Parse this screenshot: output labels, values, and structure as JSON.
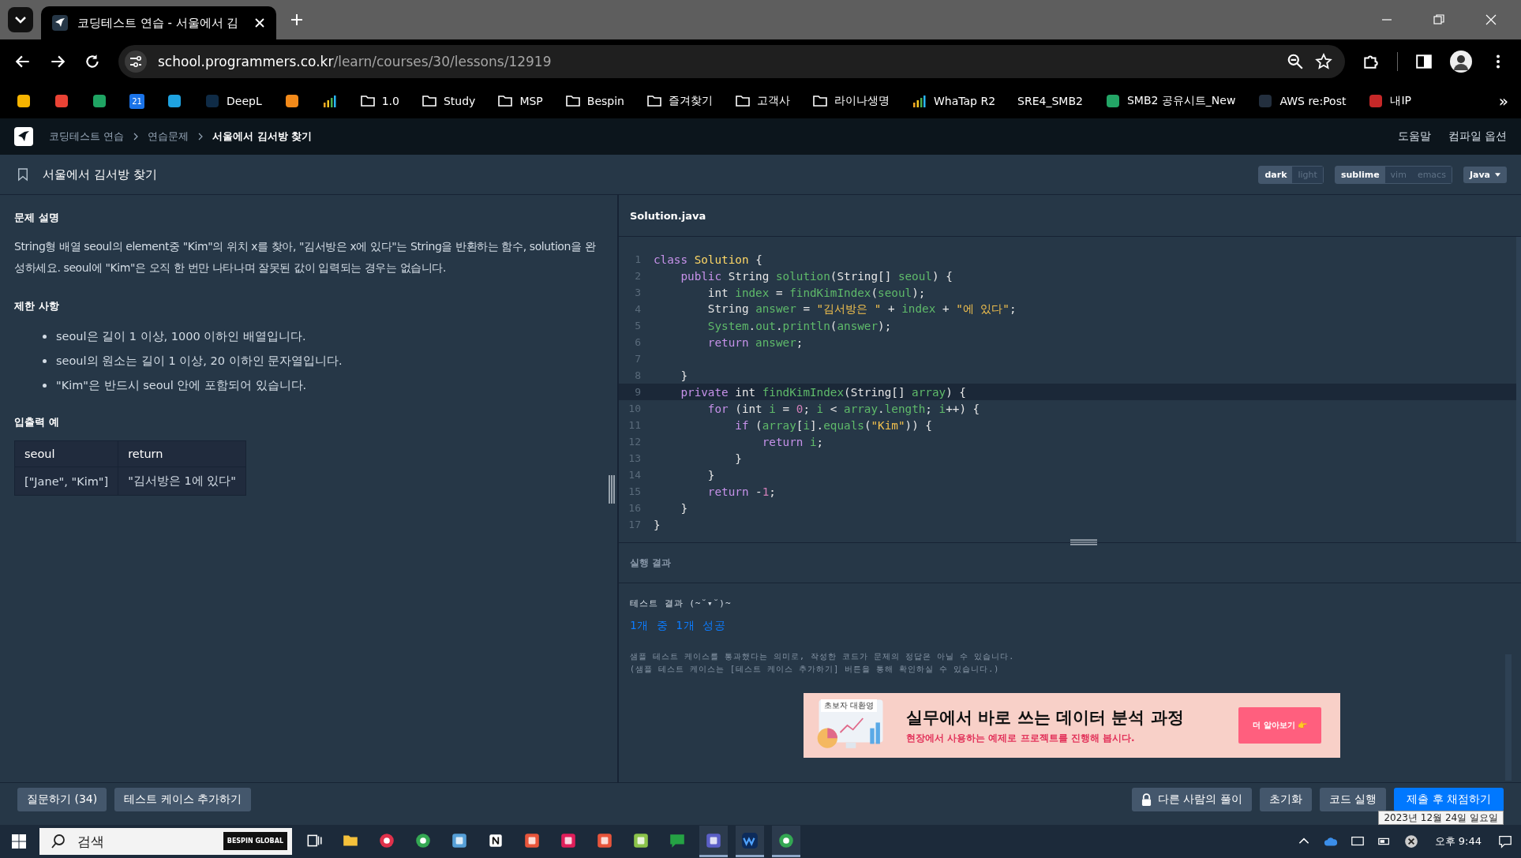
{
  "browser": {
    "tabs": [
      {
        "title": "코딩테스트 연습 - 서울에서 김",
        "selected": true
      }
    ],
    "url_host": "school.programmers.co.kr",
    "url_path": "/learn/courses/30/lessons/12919",
    "bookmarks": [
      {
        "kind": "site",
        "color": "#f6b400"
      },
      {
        "kind": "site",
        "color": "#ea4335"
      },
      {
        "kind": "site",
        "color": "#1fa463"
      },
      {
        "kind": "calendar",
        "icon_text": "21"
      },
      {
        "kind": "site",
        "color": "#1fa2e0"
      },
      {
        "kind": "site",
        "color": "#0f2b46",
        "label": "DeepL"
      },
      {
        "kind": "site",
        "color": "#f28a1a"
      },
      {
        "kind": "bars"
      },
      {
        "kind": "folder",
        "label": "1.0"
      },
      {
        "kind": "folder",
        "label": "Study"
      },
      {
        "kind": "folder",
        "label": "MSP"
      },
      {
        "kind": "folder",
        "label": "Bespin"
      },
      {
        "kind": "folder",
        "label": "즐겨찾기"
      },
      {
        "kind": "folder",
        "label": "고객사"
      },
      {
        "kind": "folder",
        "label": "라이나생명"
      },
      {
        "kind": "bars",
        "label": "WhaTap R2"
      },
      {
        "kind": "plain",
        "label": "SRE4_SMB2"
      },
      {
        "kind": "site",
        "color": "#23a566",
        "label": "SMB2 공유시트_New"
      },
      {
        "kind": "site",
        "color": "#232f3e",
        "label": "AWS re:Post"
      },
      {
        "kind": "site",
        "color": "#c62828",
        "label": "내IP"
      }
    ],
    "more": "»"
  },
  "site_nav": {
    "breadcrumb": [
      "코딩테스트 연습",
      "연습문제",
      "서울에서 김서방 찾기"
    ],
    "links": [
      "도움말",
      "컴파일 옵션"
    ]
  },
  "problem_title": "서울에서 김서방 찾기",
  "toggles": [
    [
      {
        "label": "dark",
        "selected": true
      },
      {
        "label": "light",
        "selected": false
      }
    ],
    [
      {
        "label": "sublime",
        "selected": true
      },
      {
        "label": "vim",
        "selected": false
      },
      {
        "label": "emacs",
        "selected": false
      }
    ]
  ],
  "language": "Java",
  "description": {
    "heading": "문제 설명",
    "text": "String형 배열 seoul의 element중 \"Kim\"의 위치 x를 찾아, \"김서방은 x에 있다\"는 String을 반환하는 함수, solution을 완성하세요. seoul에 \"Kim\"은 오직 한 번만 나타나며 잘못된 값이 입력되는 경우는 없습니다."
  },
  "constraints": {
    "heading": "제한 사항",
    "items": [
      "seoul은 길이 1 이상, 1000 이하인 배열입니다.",
      "seoul의 원소는 길이 1 이상, 20 이하인 문자열입니다.",
      "\"Kim\"은 반드시 seoul 안에 포함되어 있습니다."
    ]
  },
  "examples": {
    "heading": "입출력 예",
    "columns": [
      "seoul",
      "return"
    ],
    "rows": [
      [
        "[\"Jane\", \"Kim\"]",
        "\"김서방은 1에 있다\""
      ]
    ]
  },
  "editor": {
    "file": "Solution.java",
    "lines": [
      {
        "number": "1",
        "current": false,
        "tokens": [
          {
            "kind": "kw",
            "text": "class "
          },
          {
            "kind": "cls",
            "text": "Solution"
          },
          {
            "kind": "p",
            "text": " {"
          }
        ]
      },
      {
        "number": "2",
        "current": false,
        "tokens": [
          {
            "kind": "kw",
            "text": "    public"
          },
          {
            "kind": "p",
            "text": " String "
          },
          {
            "kind": "fn",
            "text": "solution"
          },
          {
            "kind": "p",
            "text": "(String[] "
          },
          {
            "kind": "fn",
            "text": "seoul"
          },
          {
            "kind": "p",
            "text": ") {"
          }
        ]
      },
      {
        "number": "3",
        "current": false,
        "tokens": [
          {
            "kind": "p",
            "text": "        int "
          },
          {
            "kind": "fn",
            "text": "index"
          },
          {
            "kind": "p",
            "text": " = "
          },
          {
            "kind": "fn",
            "text": "findKimIndex"
          },
          {
            "kind": "p",
            "text": "("
          },
          {
            "kind": "fn",
            "text": "seoul"
          },
          {
            "kind": "p",
            "text": ");"
          }
        ]
      },
      {
        "number": "4",
        "current": false,
        "tokens": [
          {
            "kind": "p",
            "text": "        String "
          },
          {
            "kind": "fn",
            "text": "answer"
          },
          {
            "kind": "p",
            "text": " = "
          },
          {
            "kind": "str",
            "text": "\"김서방은 \""
          },
          {
            "kind": "p",
            "text": " + "
          },
          {
            "kind": "fn",
            "text": "index"
          },
          {
            "kind": "p",
            "text": " + "
          },
          {
            "kind": "str",
            "text": "\"에 있다\""
          },
          {
            "kind": "p",
            "text": ";"
          }
        ]
      },
      {
        "number": "5",
        "current": false,
        "tokens": [
          {
            "kind": "fn",
            "text": "        System"
          },
          {
            "kind": "p",
            "text": "."
          },
          {
            "kind": "fn",
            "text": "out"
          },
          {
            "kind": "p",
            "text": "."
          },
          {
            "kind": "fn",
            "text": "println"
          },
          {
            "kind": "p",
            "text": "("
          },
          {
            "kind": "fn",
            "text": "answer"
          },
          {
            "kind": "p",
            "text": ");"
          }
        ]
      },
      {
        "number": "6",
        "current": false,
        "tokens": [
          {
            "kind": "kw",
            "text": "        return"
          },
          {
            "kind": "fn",
            "text": " answer"
          },
          {
            "kind": "p",
            "text": ";"
          }
        ]
      },
      {
        "number": "7",
        "current": false
      },
      {
        "number": "8",
        "current": false,
        "tokens": [
          {
            "kind": "p",
            "text": "    }"
          }
        ]
      },
      {
        "number": "9",
        "current": true,
        "tokens": [
          {
            "kind": "kw",
            "text": "    private"
          },
          {
            "kind": "p",
            "text": " int "
          },
          {
            "kind": "fn",
            "text": "findKimIndex"
          },
          {
            "kind": "p",
            "text": "(String[] "
          },
          {
            "kind": "fn",
            "text": "array"
          },
          {
            "kind": "p",
            "text": ") {"
          }
        ]
      },
      {
        "number": "10",
        "current": false,
        "tokens": [
          {
            "kind": "kw",
            "text": "        for"
          },
          {
            "kind": "p",
            "text": " (int "
          },
          {
            "kind": "fn",
            "text": "i"
          },
          {
            "kind": "p",
            "text": " = "
          },
          {
            "kind": "num",
            "text": "0"
          },
          {
            "kind": "p",
            "text": "; "
          },
          {
            "kind": "fn",
            "text": "i"
          },
          {
            "kind": "p",
            "text": " < "
          },
          {
            "kind": "fn",
            "text": "array"
          },
          {
            "kind": "p",
            "text": "."
          },
          {
            "kind": "fn",
            "text": "length"
          },
          {
            "kind": "p",
            "text": "; "
          },
          {
            "kind": "fn",
            "text": "i"
          },
          {
            "kind": "p",
            "text": "++) {"
          }
        ]
      },
      {
        "number": "11",
        "current": false,
        "tokens": [
          {
            "kind": "kw",
            "text": "            if"
          },
          {
            "kind": "p",
            "text": " ("
          },
          {
            "kind": "fn",
            "text": "array"
          },
          {
            "kind": "p",
            "text": "["
          },
          {
            "kind": "fn",
            "text": "i"
          },
          {
            "kind": "p",
            "text": "]."
          },
          {
            "kind": "fn",
            "text": "equals"
          },
          {
            "kind": "p",
            "text": "("
          },
          {
            "kind": "str",
            "text": "\"Kim\""
          },
          {
            "kind": "p",
            "text": ")) {"
          }
        ]
      },
      {
        "number": "12",
        "current": false,
        "tokens": [
          {
            "kind": "kw",
            "text": "                return"
          },
          {
            "kind": "fn",
            "text": " i"
          },
          {
            "kind": "p",
            "text": ";"
          }
        ]
      },
      {
        "number": "13",
        "current": false,
        "tokens": [
          {
            "kind": "p",
            "text": "            }"
          }
        ]
      },
      {
        "number": "14",
        "current": false,
        "tokens": [
          {
            "kind": "p",
            "text": "        }"
          }
        ]
      },
      {
        "number": "15",
        "current": false,
        "tokens": [
          {
            "kind": "kw",
            "text": "        return"
          },
          {
            "kind": "p",
            "text": " -"
          },
          {
            "kind": "num",
            "text": "1"
          },
          {
            "kind": "p",
            "text": ";"
          }
        ]
      },
      {
        "number": "16",
        "current": false,
        "tokens": [
          {
            "kind": "p",
            "text": "    }"
          }
        ]
      },
      {
        "number": "17",
        "current": false,
        "tokens": [
          {
            "kind": "p",
            "text": "}"
          }
        ]
      }
    ]
  },
  "result": {
    "heading": "실행 결과",
    "title": "테스트 결과 (~˘▾˘)~",
    "summary": "1개 중 1개 성공",
    "notes": [
      "샘플 테스트 케이스를 통과했다는 의미로, 작성한 코드가 문제의 정답은 아닐 수 있습니다.",
      "(샘플 테스트 케이스는 [테스트 케이스 추가하기] 버튼을 통해 확인하실 수 있습니다.)"
    ]
  },
  "banner": {
    "tag": "초보자 대환영",
    "title": "실무에서 바로 쓰는 데이터 분석 과정",
    "subtitle": "현장에서 사용하는 예제로 프로젝트를 진행해 봅시다.",
    "button": "더 알아보기 👉"
  },
  "actions_left": [
    "질문하기 (34)",
    "테스트 케이스 추가하기"
  ],
  "actions_right": [
    {
      "label": "다른 사람의 풀이",
      "kind": "lock"
    },
    {
      "label": "초기화",
      "kind": "plain"
    },
    {
      "label": "코드 실행",
      "kind": "plain"
    },
    {
      "label": "제출 후 채점하기",
      "kind": "primary"
    }
  ],
  "taskbar": {
    "search_placeholder": "검색",
    "search_badge": "BESPIN GLOBAL",
    "apps": [
      {
        "kind": "taskview",
        "running": false
      },
      {
        "kind": "folder",
        "running": false
      },
      {
        "kind": "ring",
        "running": false
      },
      {
        "kind": "globe",
        "running": false
      },
      {
        "kind": "photo",
        "running": false
      },
      {
        "kind": "notion",
        "running": false
      },
      {
        "kind": "stripes",
        "running": false
      },
      {
        "kind": "slack",
        "running": false
      },
      {
        "kind": "swirl",
        "running": false
      },
      {
        "kind": "sheet",
        "running": false
      },
      {
        "kind": "chat",
        "running": false
      },
      {
        "kind": "teams",
        "running": true
      },
      {
        "kind": "wave",
        "running": true
      },
      {
        "kind": "globe",
        "running": true
      }
    ],
    "time": "오후 9:44",
    "tooltip": "2023년 12월 24일 일요일"
  }
}
